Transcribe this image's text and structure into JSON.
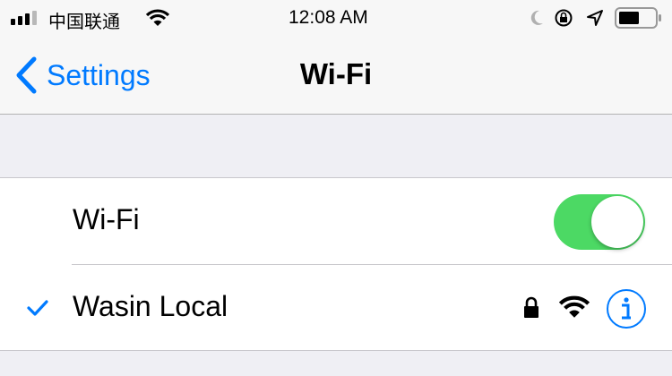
{
  "status_bar": {
    "carrier": "中国联通",
    "time": "12:08 AM",
    "signal_bars": 3,
    "battery_percent": 55,
    "icons": [
      "cellular-signal-icon",
      "wifi-icon",
      "moon-icon",
      "rotation-lock-icon",
      "location-arrow-icon",
      "battery-icon"
    ]
  },
  "nav": {
    "back_label": "Settings",
    "title": "Wi-Fi"
  },
  "wifi_toggle": {
    "label": "Wi-Fi",
    "on": true
  },
  "networks": [
    {
      "name": "Wasin Local",
      "selected": true,
      "secured": true
    }
  ],
  "colors": {
    "accent": "#007aff",
    "toggle_on": "#4cd964",
    "background": "#efeff4"
  }
}
